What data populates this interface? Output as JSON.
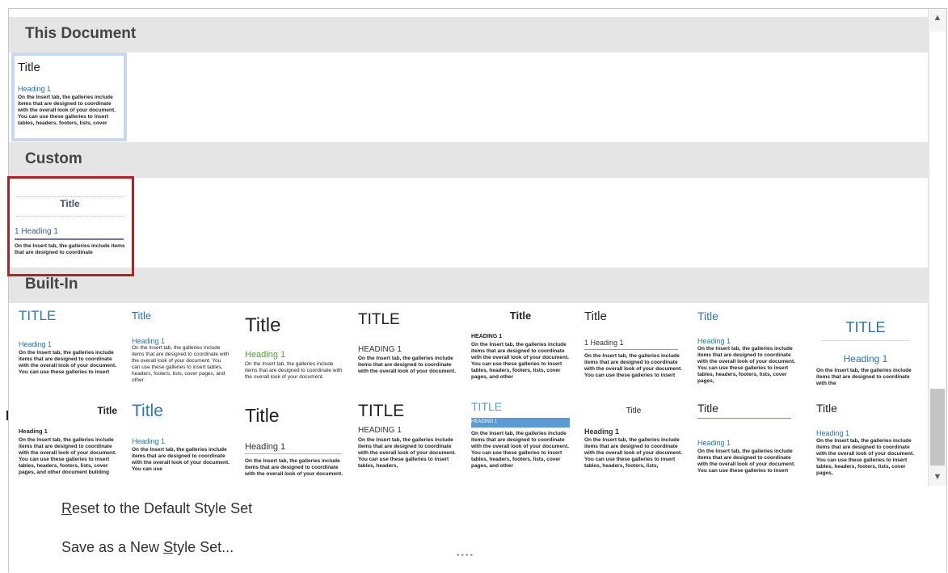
{
  "sections": {
    "this_document": "This Document",
    "custom": "Custom",
    "built_in": "Built-In"
  },
  "this_document_thumb": {
    "title": "Title",
    "heading": "Heading 1",
    "body": "On the Insert tab, the galleries include items that are designed to coordinate with the overall look of your document. You can use these galleries to insert tables, headers, footers, lists, cover"
  },
  "custom_thumb": {
    "title": "Title",
    "heading": "1  Heading 1",
    "body": "On the Insert tab, the galleries include items that are designed to coordinate"
  },
  "builtin_row1": [
    {
      "title": "TITLE",
      "heading": "Heading 1",
      "body": "On the Insert tab, the galleries include items that are designed to coordinate with the overall look of your document. You can use these galleries to insert"
    },
    {
      "title": "Title",
      "heading": "Heading 1",
      "body": "On the Insert tab, the galleries include items that are designed to coordinate with the overall look of your document. You can use these galleries to insert tables, headers, footers, lists, cover pages, and other"
    },
    {
      "title": "Title",
      "heading": "Heading 1",
      "body": "On the Insert tab, the galleries include items that are designed to coordinate with the overall look of your document."
    },
    {
      "title": "TITLE",
      "heading": "HEADING 1",
      "body": "On the Insert tab, the galleries include items that are designed to coordinate with the overall look of your document."
    },
    {
      "title": "Title",
      "heading": "HEADING 1",
      "body": "On the Insert tab, the galleries include items that are designed to coordinate with the overall look of your document. You can use these galleries to insert tables, headers, footers, lists, cover pages, and other"
    },
    {
      "title": "Title",
      "heading": "1  Heading 1",
      "body": "On the Insert tab, the galleries include items that are designed to coordinate with the overall look of your document. You can use these galleries to insert"
    },
    {
      "title": "Title",
      "heading": "Heading 1",
      "body": "On the Insert tab, the galleries include items that are designed to coordinate with the overall look of your document. You can use these galleries to insert tables, headers, footers, lists, cover pages,"
    },
    {
      "title": "TITLE",
      "heading": "Heading 1",
      "body": "On the Insert tab, the galleries include items that are designed to coordinate with the"
    }
  ],
  "builtin_row2": [
    {
      "title": "Title",
      "heading": "Heading 1",
      "body": "On the Insert tab, the galleries include items that are designed to coordinate with the overall look of your document. You can use these galleries to insert tables, headers, footers, lists, cover pages, and other document building"
    },
    {
      "title": "Title",
      "heading": "Heading 1",
      "body": "On the Insert tab, the galleries include items that are designed to coordinate with the overall look of your document. You can use"
    },
    {
      "title": "Title",
      "heading": "Heading 1",
      "body": "On the Insert tab, the galleries include items that are designed to coordinate with the overall look of your document."
    },
    {
      "title": "TITLE",
      "heading": "HEADING 1",
      "body": "On the Insert tab, the galleries include items that are designed to coordinate with the overall look of your document. You can use these galleries to insert tables, headers,"
    },
    {
      "title": "TITLE",
      "heading": "HEADING 1",
      "body": "On the Insert tab, the galleries include items that are designed to coordinate with the overall look of your document. You can use these galleries to insert tables, headers, footers, lists, cover pages, and other"
    },
    {
      "title": "Title",
      "heading": "Heading 1",
      "body": "On the Insert tab, the galleries include items that are designed to coordinate with the overall look of your document. You can use these galleries to insert tables, headers, footers, lists,"
    },
    {
      "title": "Title",
      "heading": "Heading 1",
      "body": "On the Insert tab, the galleries include items that are designed to coordinate with the overall look of your document. You can use these galleries to insert"
    },
    {
      "title": "Title",
      "heading": "Heading 1",
      "body": "On the Insert tab, the galleries include items that are designed to coordinate with the overall look of your document. You can use these galleries to insert tables, headers, footers, lists, cover pages,"
    }
  ],
  "menu": {
    "reset_pre": "",
    "reset_accel": "R",
    "reset_post": "eset to the Default Style Set",
    "save_pre": "Save as a New ",
    "save_accel": "S",
    "save_post": "tyle Set..."
  },
  "icons": {
    "scroll_up": "scroll-up-arrow-icon",
    "scroll_down": "scroll-down-arrow-icon",
    "resize_grip": "resize-grip-icon"
  },
  "colors": {
    "section_bg": "#e5e5e5",
    "heading_blue": "#2e74b5",
    "highlight_red": "#b22222",
    "selected_border": "#c7d9f0"
  }
}
